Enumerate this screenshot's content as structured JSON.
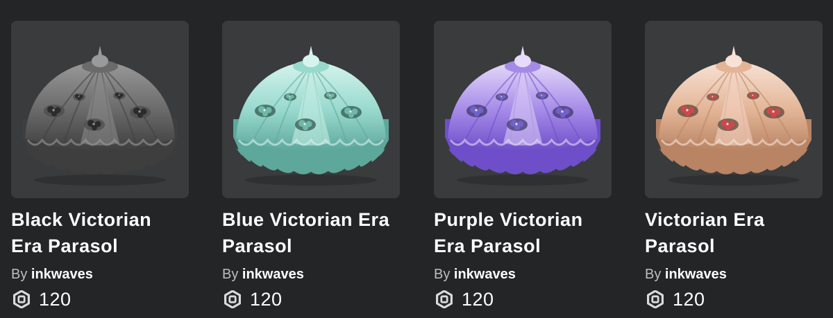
{
  "items": [
    {
      "name": "Black Victorian Era Parasol",
      "creator_prefix": "By",
      "creator": "inkwaves",
      "price": "120",
      "colors": {
        "light": "#9a9a9a",
        "mid": "#6a6a6a",
        "dark": "#3e3e3e",
        "panel": "#888888",
        "flower": "#2b2b2b",
        "leaf": "#4a4a4a"
      }
    },
    {
      "name": "Blue Victorian Era Parasol",
      "creator_prefix": "By",
      "creator": "inkwaves",
      "price": "120",
      "colors": {
        "light": "#d6f4ee",
        "mid": "#98d9cd",
        "dark": "#5ea79b",
        "panel": "#c3ece4",
        "flower": "#6fb8a8",
        "leaf": "#2e4f47"
      }
    },
    {
      "name": "Purple Victorian Era Parasol",
      "creator_prefix": "By",
      "creator": "inkwaves",
      "price": "120",
      "colors": {
        "light": "#e6dcfa",
        "mid": "#a58ae8",
        "dark": "#6e4fc9",
        "panel": "#d8c9f6",
        "flower": "#6f62c9",
        "leaf": "#3c3160"
      }
    },
    {
      "name": "Victorian Era Parasol",
      "creator_prefix": "By",
      "creator": "inkwaves",
      "price": "120",
      "colors": {
        "light": "#f8e2d6",
        "mid": "#e3b596",
        "dark": "#b88464",
        "panel": "#f3d2c1",
        "flower": "#d0474a",
        "leaf": "#4f4036"
      }
    }
  ],
  "currency_icon": "robux-icon"
}
